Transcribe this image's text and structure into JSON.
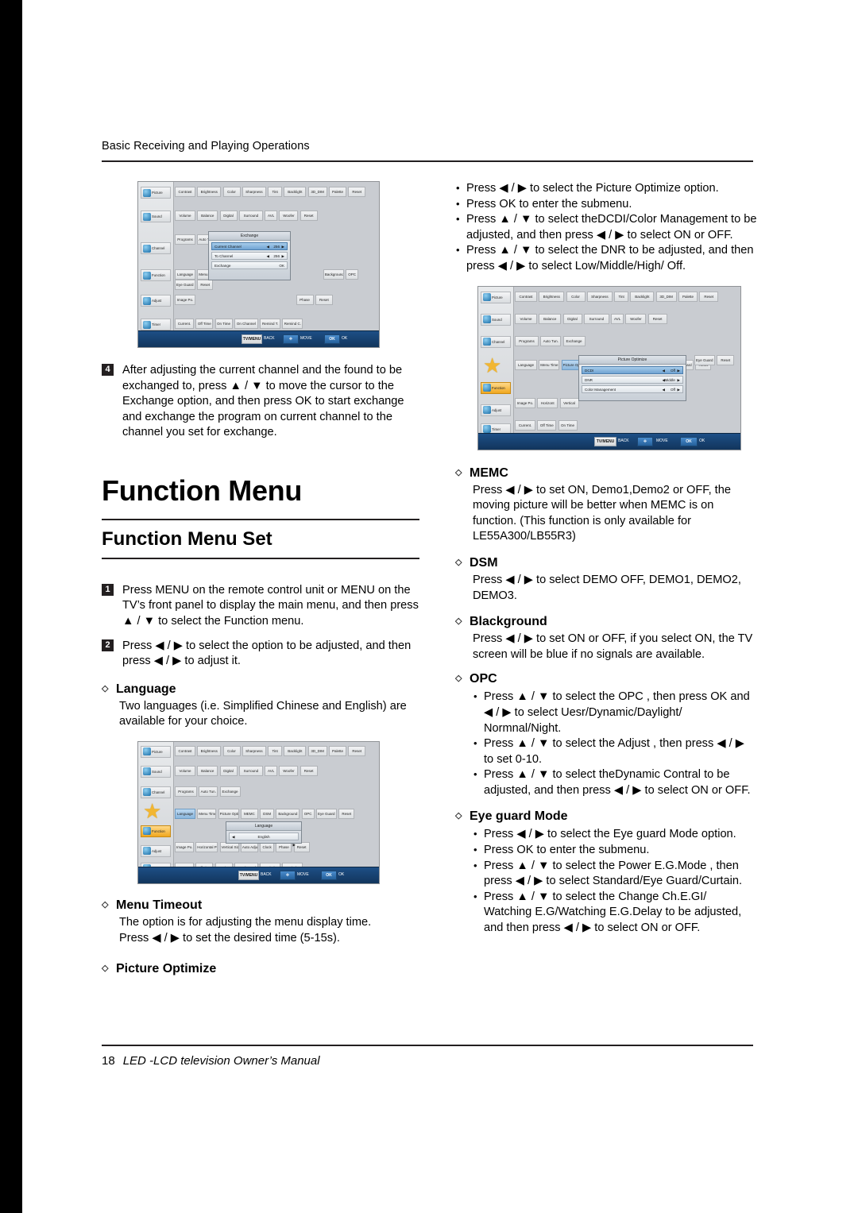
{
  "header": {
    "running_head": "Basic Receiving and Playing Operations"
  },
  "footer": {
    "page_number": "18",
    "text": "LED -LCD television Owner’s Manual"
  },
  "left": {
    "step4": {
      "num": "4",
      "text": "After adjusting the current channel and the found to be exchanged to, press ▲ / ▼ to move the cursor to the Exchange option, and then press OK to start exchange and exchange the program on current channel to the channel you set for exchange."
    },
    "title": "Function Menu",
    "subtitle": "Function Menu Set",
    "step1": {
      "num": "1",
      "text": "Press MENU on the remote control unit or MENU on the TV’s front panel to display the main menu, and then press ▲ / ▼ to select the Function menu."
    },
    "step2": {
      "num": "2",
      "text": "Press ◀ / ▶ to select the option to be adjusted, and then press ◀ / ▶ to adjust it."
    },
    "language": {
      "heading": "Language",
      "body": "Two languages (i.e. Simplified Chinese and English) are available for your choice."
    },
    "menu_timeout": {
      "heading": "Menu Timeout",
      "body_line1": "The option is for adjusting the menu display time.",
      "body_line2": "Press ◀ / ▶ to set the desired time (5-15s)."
    },
    "picture_optimize": {
      "heading": "Picture Optimize"
    }
  },
  "right": {
    "bullets_top": [
      "Press ◀ / ▶ to select the Picture Optimize option.",
      "Press OK  to enter the submenu.",
      "Press ▲ / ▼ to select theDCDI/Color Management  to be adjusted, and then press ◀ / ▶ to select ON or OFF.",
      "Press ▲ / ▼ to select the DNR to be adjusted, and then press ◀ / ▶ to select Low/Middle/High/ Off."
    ],
    "memc": {
      "heading": "MEMC",
      "body": "Press ◀ / ▶ to set ON, Demo1,Demo2 or OFF, the moving picture will be better when MEMC is on function. (This function is only available for LE55A300/LB55R3)"
    },
    "dsm": {
      "heading": "DSM",
      "body": "Press ◀ / ▶ to select DEMO OFF, DEMO1, DEMO2, DEMO3."
    },
    "blackground": {
      "heading": "Blackground",
      "body": "Press ◀ / ▶ to set ON or OFF, if you select ON, the TV screen will be blue if no signals are available."
    },
    "opc": {
      "heading": "OPC",
      "bullets": [
        "Press ▲ / ▼ to select the OPC , then press OK and ◀ / ▶ to select Uesr/Dynamic/Daylight/ Normnal/Night.",
        "Press ▲ / ▼ to select the Adjust , then press ◀ / ▶ to set 0-10.",
        "Press ▲ / ▼ to select theDynamic Contral to be adjusted, and then press ◀ / ▶ to select ON or OFF."
      ]
    },
    "eye_guard": {
      "heading": "Eye guard Mode",
      "bullets": [
        "Press ◀ / ▶ to select the Eye guard Mode option.",
        "Press OK  to enter the submenu.",
        "Press ▲ / ▼ to select the Power E.G.Mode , then press ◀ / ▶ to select Standard/Eye Guard/Curtain.",
        "Press ▲ / ▼ to select the Change Ch.E.GI/ Watching E.G/Watching E.G.Delay  to be adjusted, and then press ◀ / ▶ to select ON or OFF."
      ]
    }
  },
  "osd": {
    "rail": [
      "Picture",
      "Sound",
      "Channel",
      "Function",
      "Adjust",
      "Timer"
    ],
    "bottom_buttons": [
      "TV/MENU",
      "BACK",
      "MOVE",
      "OK"
    ],
    "bottom_ok_label": "OK",
    "picture_row": [
      "Contrast",
      "Brightness",
      "Color",
      "Sharpness",
      "Tint",
      "Backlight",
      "3D_DIM",
      "Palette",
      "Reset"
    ],
    "sound_row": [
      "Volume",
      "Balance",
      "Digital",
      "Surround",
      "AVL",
      "Woofer",
      "Reset"
    ],
    "channel_row_a": [
      "Programs",
      "Auto Tun.",
      "Exchange"
    ],
    "channel_row_b": [
      "Current.",
      "Off Time",
      "On Time",
      "On Channel",
      "Remind T.",
      "Remind C."
    ],
    "function_row": [
      "Language",
      "Menu Time out",
      "Picture Optimize",
      "MEMC",
      "DSM",
      "Background",
      "OPC",
      "Eye Guard Mode",
      "Reset"
    ],
    "adjust_row": [
      "Image Po.",
      "Horizontal Position",
      "Vertical Size",
      "Auto Adjust",
      "Clock",
      "Phase",
      "Reset"
    ],
    "adjust_row2": [
      "Image Po.",
      "Horizont",
      "Vertical"
    ],
    "timer_row": [
      "Current.",
      "Off Time",
      "On Time"
    ],
    "exchange_popup": {
      "title": "Exchange",
      "rows": [
        {
          "label": "Current Channel",
          "value": "256"
        },
        {
          "label": "To Channel",
          "value": "256"
        },
        {
          "label": "Exchange",
          "value": "OK"
        }
      ]
    },
    "language_popup": {
      "title": "Language",
      "value": "English"
    },
    "picture_optimize_popup": {
      "title": "Picture Optimize",
      "rows": [
        {
          "label": "DCDI",
          "value": "Off"
        },
        {
          "label": "DNR",
          "value": "Middle"
        },
        {
          "label": "Color Management",
          "value": "Off"
        }
      ]
    }
  }
}
